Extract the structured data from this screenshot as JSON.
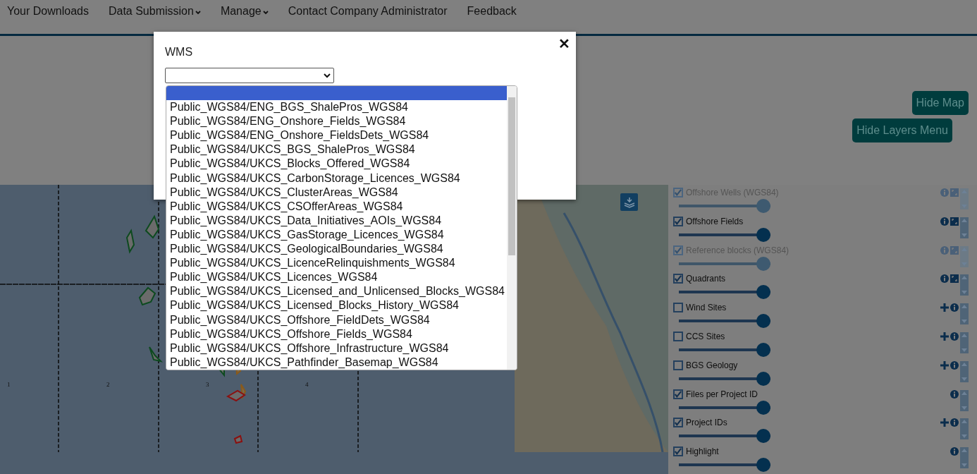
{
  "nav": [
    {
      "label": "Your Downloads",
      "dropdown": false
    },
    {
      "label": "Data Submission",
      "dropdown": true
    },
    {
      "label": "Manage",
      "dropdown": true
    },
    {
      "label": "Contact Company Administrator",
      "dropdown": false
    },
    {
      "label": "Feedback",
      "dropdown": false
    }
  ],
  "buttons": [
    {
      "label": "Hide Map"
    },
    {
      "label": "Hide Layers Menu"
    }
  ],
  "map": {
    "grid_labels": [
      "1",
      "2",
      "3",
      "4"
    ]
  },
  "layers": [
    {
      "name": "Offshore Wells (WGS84)",
      "checked": true,
      "disabled": true,
      "kind": "legend",
      "level": 1
    },
    {
      "name": "Offshore Fields",
      "checked": true,
      "disabled": false,
      "kind": "legend",
      "level": 1
    },
    {
      "name": "Reference blocks (WGS84)",
      "checked": true,
      "disabled": true,
      "kind": "legend",
      "level": 1
    },
    {
      "name": "Quadrants",
      "checked": true,
      "disabled": false,
      "kind": "legend",
      "level": 1
    },
    {
      "name": "Wind Sites",
      "checked": false,
      "disabled": false,
      "kind": "add",
      "level": 1
    },
    {
      "name": "CCS Sites",
      "checked": false,
      "disabled": false,
      "kind": "add",
      "level": 1
    },
    {
      "name": "BGS Geology",
      "checked": false,
      "disabled": false,
      "kind": "add",
      "level": 1
    },
    {
      "name": "Files per Project ID",
      "checked": true,
      "disabled": false,
      "kind": "info",
      "level": 1
    },
    {
      "name": "Project IDs",
      "checked": true,
      "disabled": false,
      "kind": "add",
      "level": 1
    },
    {
      "name": "Highlight",
      "checked": true,
      "disabled": false,
      "kind": "info",
      "level": 1
    }
  ],
  "dialog": {
    "title": "WMS",
    "close": "✕",
    "blank_option": {
      "selected": true
    },
    "options": [
      {
        "label": "Public_WGS84/ENG_BGS_ShalePros_WGS84",
        "selected": false
      },
      {
        "label": "Public_WGS84/ENG_Onshore_Fields_WGS84",
        "selected": false
      },
      {
        "label": "Public_WGS84/ENG_Onshore_FieldsDets_WGS84",
        "selected": false
      },
      {
        "label": "Public_WGS84/UKCS_BGS_ShalePros_WGS84",
        "selected": false
      },
      {
        "label": "Public_WGS84/UKCS_Blocks_Offered_WGS84",
        "selected": false
      },
      {
        "label": "Public_WGS84/UKCS_CarbonStorage_Licences_WGS84",
        "selected": false
      },
      {
        "label": "Public_WGS84/UKCS_ClusterAreas_WGS84",
        "selected": false
      },
      {
        "label": "Public_WGS84/UKCS_CSOfferAreas_WGS84",
        "selected": false
      },
      {
        "label": "Public_WGS84/UKCS_Data_Initiatives_AOIs_WGS84",
        "selected": false
      },
      {
        "label": "Public_WGS84/UKCS_GasStorage_Licences_WGS84",
        "selected": false
      },
      {
        "label": "Public_WGS84/UKCS_GeologicalBoundaries_WGS84",
        "selected": false
      },
      {
        "label": "Public_WGS84/UKCS_LicenceRelinquishments_WGS84",
        "selected": false
      },
      {
        "label": "Public_WGS84/UKCS_Licences_WGS84",
        "selected": false
      },
      {
        "label": "Public_WGS84/UKCS_Licensed_and_Unlicensed_Blocks_WGS84",
        "selected": false
      },
      {
        "label": "Public_WGS84/UKCS_Licensed_Blocks_History_WGS84",
        "selected": false
      },
      {
        "label": "Public_WGS84/UKCS_Offshore_FieldDets_WGS84",
        "selected": false
      },
      {
        "label": "Public_WGS84/UKCS_Offshore_Fields_WGS84",
        "selected": false
      },
      {
        "label": "Public_WGS84/UKCS_Offshore_Infrastructure_WGS84",
        "selected": false
      },
      {
        "label": "Public_WGS84/UKCS_Pathfinder_Basemap_WGS84",
        "selected": false
      }
    ]
  }
}
